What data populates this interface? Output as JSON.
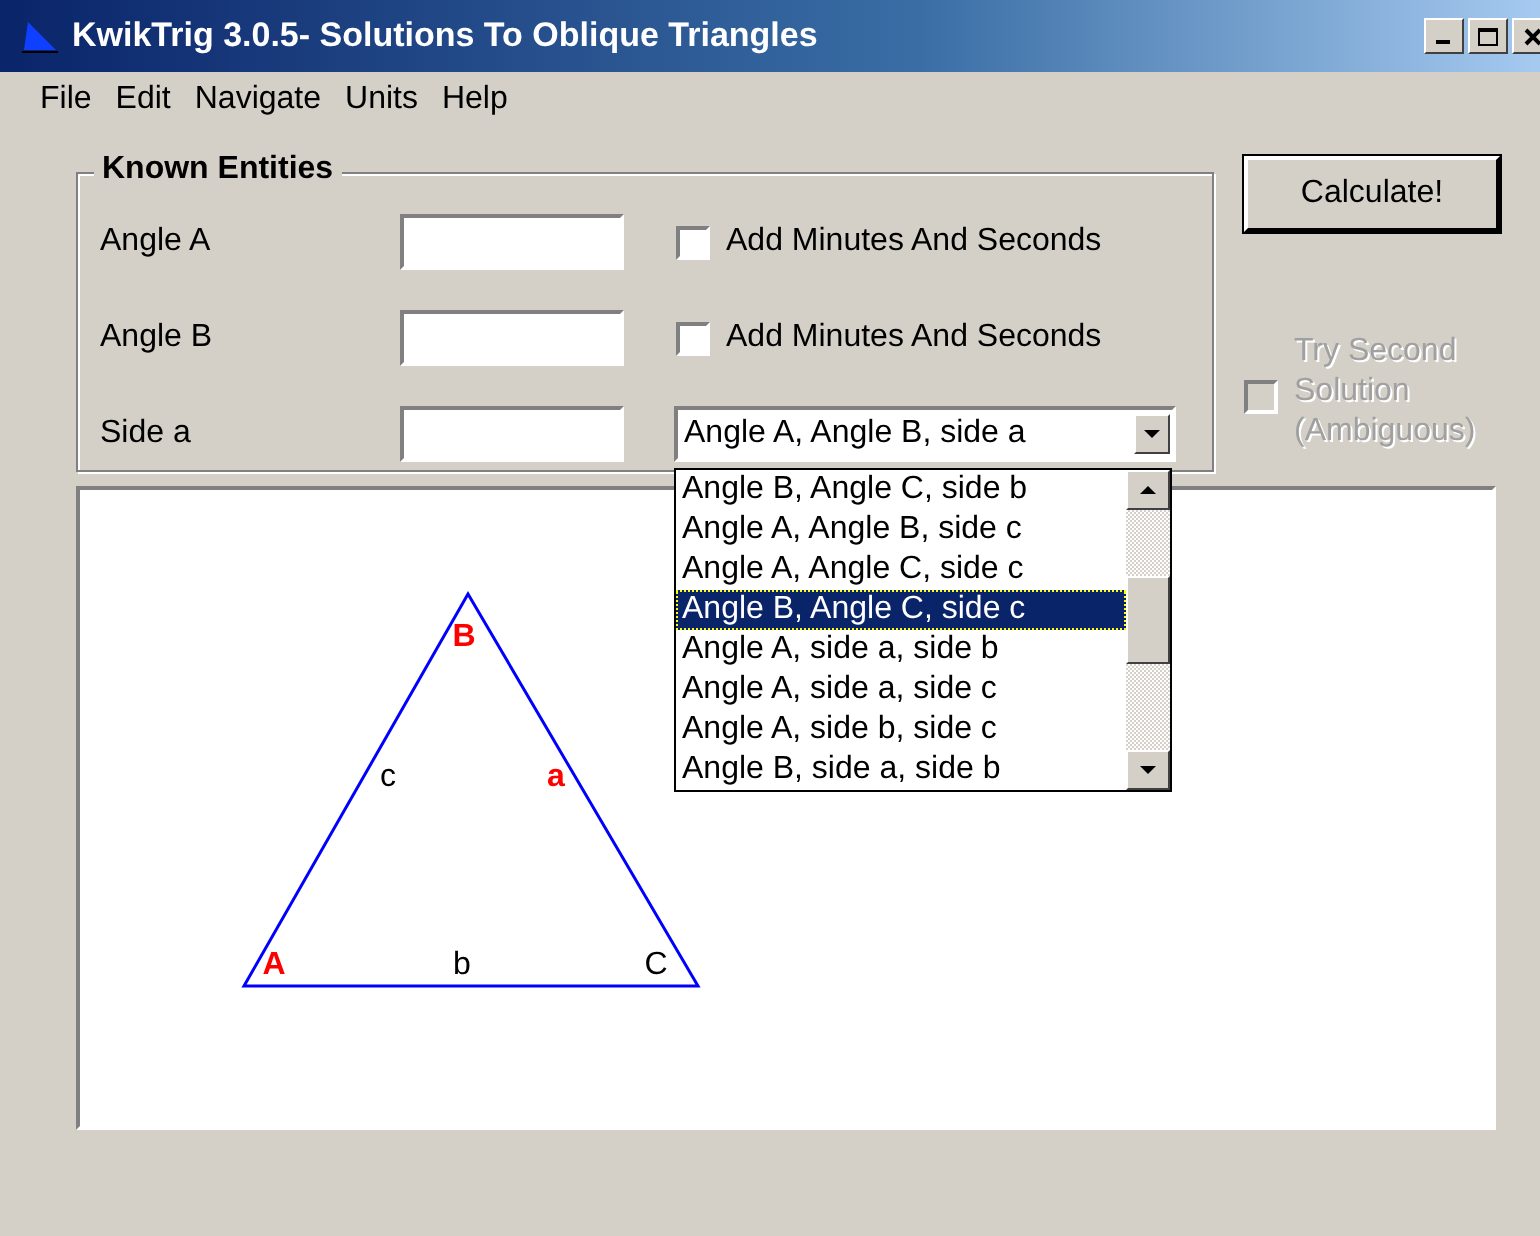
{
  "window": {
    "title": "KwikTrig 3.0.5- Solutions To Oblique Triangles"
  },
  "menu": [
    "File",
    "Edit",
    "Navigate",
    "Units",
    "Help"
  ],
  "known_entities": {
    "title": "Known Entities",
    "rows": [
      {
        "label": "Angle A",
        "kind": "check",
        "checkbox": {
          "label": "Add Minutes And Seconds",
          "checked": false
        }
      },
      {
        "label": "Angle B",
        "kind": "check",
        "checkbox": {
          "label": "Add Minutes And Seconds",
          "checked": false
        }
      },
      {
        "label": "Side a",
        "kind": "combo",
        "combo": {
          "value": "Angle A, Angle B, side a",
          "expanded": true,
          "options": [
            {
              "label": "Angle B, Angle C, side b",
              "selected": false
            },
            {
              "label": "Angle A, Angle B, side c",
              "selected": false
            },
            {
              "label": "Angle A, Angle C, side c",
              "selected": false
            },
            {
              "label": "Angle B, Angle C, side c",
              "selected": true
            },
            {
              "label": "Angle A, side a, side b",
              "selected": false
            },
            {
              "label": "Angle A, side a, side c",
              "selected": false
            },
            {
              "label": "Angle A, side b, side c",
              "selected": false
            },
            {
              "label": "Angle B, side a, side b",
              "selected": false
            }
          ]
        }
      }
    ]
  },
  "calculate_button": "Calculate!",
  "second_solution": {
    "label_lines": [
      "Try Second",
      "Solution",
      "(Ambiguous)"
    ],
    "checked": false,
    "disabled": true
  },
  "diagram": {
    "vertices": [
      {
        "label": "A",
        "known": true
      },
      {
        "label": "B",
        "known": true
      },
      {
        "label": "C",
        "known": false
      }
    ],
    "sides": [
      {
        "label": "a",
        "known": true
      },
      {
        "label": "b",
        "known": false
      },
      {
        "label": "c",
        "known": false
      }
    ]
  }
}
